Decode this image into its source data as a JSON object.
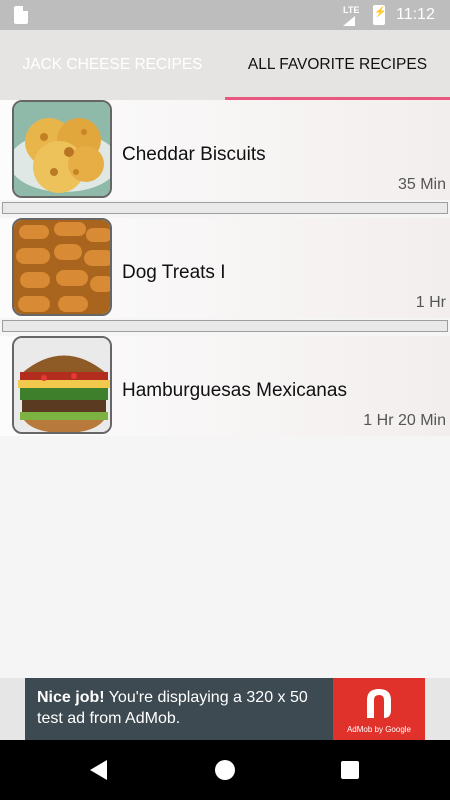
{
  "status_bar": {
    "network": "LTE",
    "time": "11:12"
  },
  "tabs": [
    {
      "label": "JACK CHEESE RECIPES",
      "active": false
    },
    {
      "label": "ALL FAVORITE RECIPES",
      "active": true
    }
  ],
  "recipes": [
    {
      "title": "Cheddar Biscuits",
      "time": "35 Min",
      "image": "cheddar-biscuits"
    },
    {
      "title": "Dog Treats I",
      "time": "1 Hr",
      "image": "dog-treats"
    },
    {
      "title": "Hamburguesas Mexicanas",
      "time": "1 Hr 20 Min",
      "image": "hamburger"
    }
  ],
  "ad": {
    "headline": "Nice job!",
    "text": "You're displaying a 320 x 50 test ad from AdMob.",
    "brand": "AdMob by Google"
  },
  "colors": {
    "accent": "#e9567e",
    "ad_background": "#3d4a52",
    "ad_logo": "#e0312b"
  }
}
